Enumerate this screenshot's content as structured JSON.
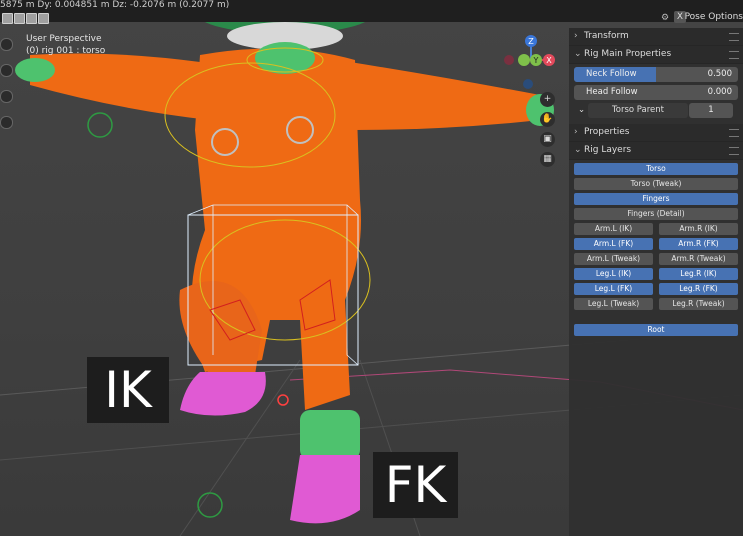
{
  "status_bar": {
    "text": "5875 m    Dy: 0.004851 m    Dz: -0.2076 m (0.2077 m)"
  },
  "header": {
    "pose_options_label": "Pose Options",
    "close_glyph": "X"
  },
  "viewport": {
    "perspective_label": "User Perspective",
    "object_label": "(0) rig 001 : torso",
    "overlay_ik": "IK",
    "overlay_fk": "FK",
    "gizmo_axis_z": "Z",
    "gizmo_axis_y": "Y",
    "gizmo_axis_x": "X",
    "colors": {
      "body": "#ef6a14",
      "arm_ends": "#4ec26e",
      "feet": "#e05ad3"
    }
  },
  "sidebar": {
    "transform_header": "Transform",
    "rig_main_header": "Rig Main Properties",
    "neck_follow": {
      "label": "Neck Follow",
      "value": "0.500",
      "fraction": 0.5
    },
    "head_follow": {
      "label": "Head Follow",
      "value": "0.000",
      "fraction": 0.0
    },
    "torso_parent": {
      "label": "Torso Parent",
      "value": "1"
    },
    "properties_header": "Properties",
    "rig_layers_header": "Rig Layers",
    "layers": {
      "torso": "Torso",
      "torso_tweak": "Torso (Tweak)",
      "fingers": "Fingers",
      "fingers_detail": "Fingers (Detail)",
      "arm_l_ik": "Arm.L (IK)",
      "arm_r_ik": "Arm.R (IK)",
      "arm_l_fk": "Arm.L (FK)",
      "arm_r_fk": "Arm.R (FK)",
      "arm_l_tweak": "Arm.L (Tweak)",
      "arm_r_tweak": "Arm.R (Tweak)",
      "leg_l_ik": "Leg.L (IK)",
      "leg_r_ik": "Leg.R (IK)",
      "leg_l_fk": "Leg.L (FK)",
      "leg_r_fk": "Leg.R (FK)",
      "leg_l_tweak": "Leg.L (Tweak)",
      "leg_r_tweak": "Leg.R (Tweak)",
      "root": "Root"
    },
    "accent": "#4772b3"
  }
}
